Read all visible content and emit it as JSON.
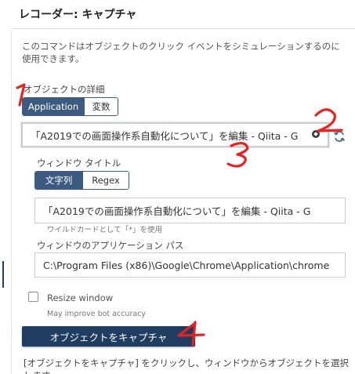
{
  "header": {
    "title": "レコーダー: キャプチャ"
  },
  "description": "このコマンドはオブジェクトのクリック イベントをシミュレーションするのに使用できます。",
  "object_details": {
    "label": "オブジェクトの詳細",
    "toggle": {
      "active": "Application",
      "inactive": "変数"
    },
    "input_value": "「A2019での画面操作系自動化について」を編集 - Qiita - G"
  },
  "window_title": {
    "label": "ウィンドウ タイトル",
    "toggle": {
      "active": "文字列",
      "inactive": "Regex"
    },
    "input_value": "「A2019での画面操作系自動化について」を編集 - Qiita - G",
    "hint": "ワイルドカードとして「*」を使用"
  },
  "app_path": {
    "label": "ウィンドウのアプリケーション パス",
    "input_value": "C:\\Program Files (x86)\\Google\\Chrome\\Application\\chrome"
  },
  "resize": {
    "label": "Resize window",
    "hint": "May improve bot accuracy",
    "checked": false
  },
  "capture_button": {
    "label": "オブジェクトをキャプチャ"
  },
  "bottom_text": "[オブジェクトをキャプチャ] をクリックし、ウィンドウからオブジェクトを選択します。",
  "annotations": [
    "1",
    "2",
    "3",
    "4"
  ],
  "colors": {
    "toggle_active": "#3d5b80",
    "primary_button": "#1e3d60",
    "annotation": "#e8231f"
  }
}
